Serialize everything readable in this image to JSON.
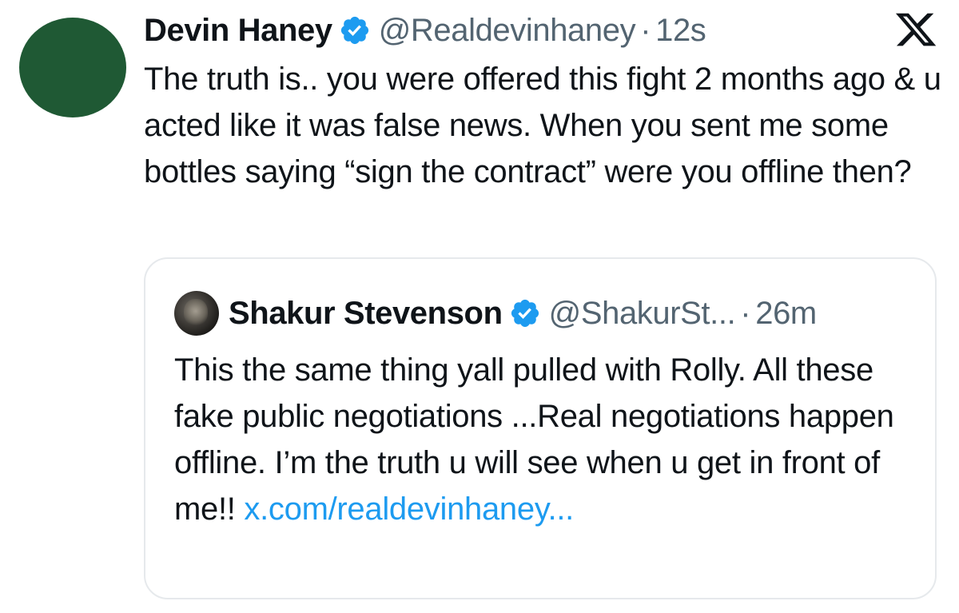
{
  "tweet": {
    "author_name": "Devin Haney",
    "handle": "@Realdevinhaney",
    "separator": "·",
    "time": "12s",
    "text": "The truth is.. you were offered this fight 2 months ago & u acted like it was false news. When you sent me some bottles saying “sign the contract” were you offline then?",
    "avatar_color": "#1f5934",
    "verified_color": "#1d9bf0"
  },
  "quoted_tweet": {
    "author_name": "Shakur Stevenson",
    "handle": "@ShakurSt...",
    "separator": "·",
    "time": "26m",
    "text": "This the same thing yall pulled with Rolly. All these fake public negotiations ...Real negotiations happen offline. I’m the truth u will see when u get in front of me!! ",
    "link_text": "x.com/realdevinhaney...",
    "link_color": "#1d9bf0"
  },
  "icons": {
    "verified": "verified-badge-icon",
    "brand": "x-logo-icon"
  }
}
